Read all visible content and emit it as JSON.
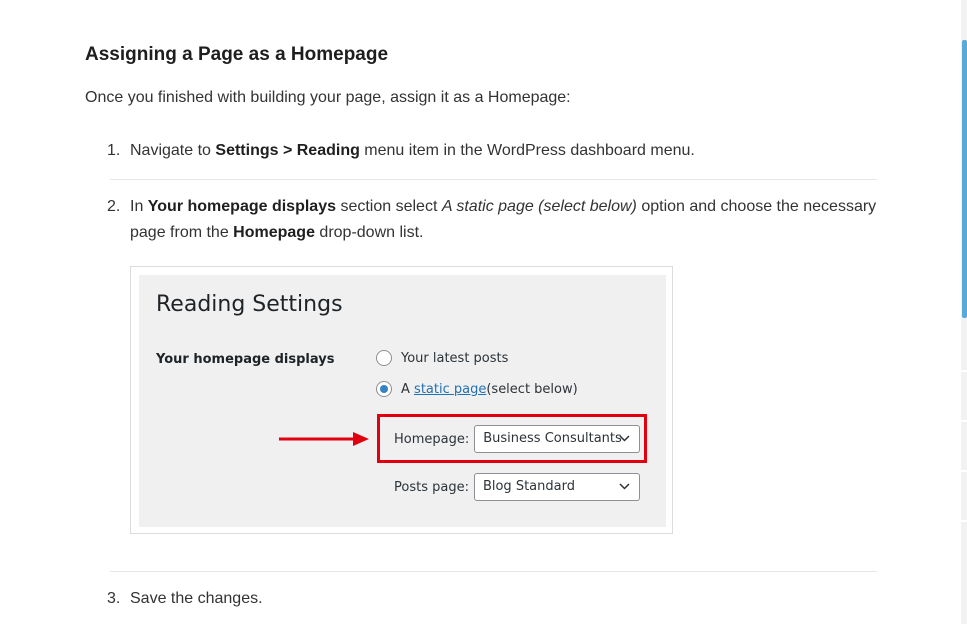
{
  "article": {
    "heading": "Assigning a Page as a Homepage",
    "intro": "Once you finished with building your page, assign it as a Homepage:",
    "steps": [
      {
        "num": "1.",
        "pre": "Navigate to ",
        "bold1": "Settings > Reading",
        "post": " menu item in the WordPress dashboard menu."
      },
      {
        "num": "2.",
        "pre": "In ",
        "bold1": "Your homepage displays",
        "mid1": " section select ",
        "italic": "A static page (select below)",
        "mid2": " option and choose the necessary page from the ",
        "bold2": "Homepage",
        "post": " drop-down list."
      },
      {
        "num": "3.",
        "text": "Save the changes."
      }
    ]
  },
  "screenshot": {
    "title": "Reading Settings",
    "section_label": "Your homepage displays",
    "option_latest": "Your latest posts",
    "option_static_prefix": "A ",
    "option_static_link": "static page",
    "option_static_suffix": " (select below)",
    "homepage_label": "Homepage:",
    "homepage_value": "Business Consultants",
    "posts_label": "Posts page:",
    "posts_value": "Blog Standard",
    "highlight_color": "#e0000f",
    "selected_option": "static-page"
  },
  "colors": {
    "accent_link": "#2271b1",
    "radio_checked": "#3582c4",
    "scrollbar": "#5aa9d6"
  }
}
